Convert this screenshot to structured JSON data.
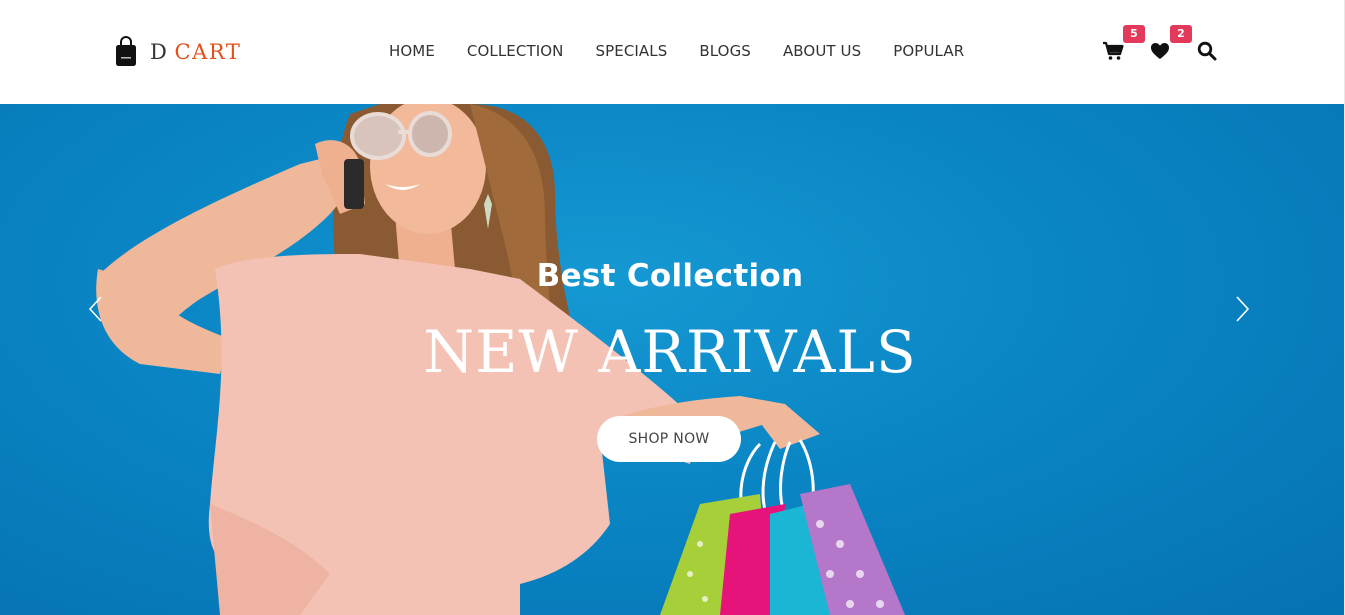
{
  "brand": {
    "name_prefix": "D",
    "name_accent": "CART",
    "icon": "shopping-bag-icon",
    "accent_color": "#e1521a"
  },
  "nav": {
    "items": [
      {
        "label": "HOME"
      },
      {
        "label": "COLLECTION"
      },
      {
        "label": "SPECIALS"
      },
      {
        "label": "BLOGS"
      },
      {
        "label": "ABOUT US"
      },
      {
        "label": "POPULAR"
      }
    ]
  },
  "header_icons": {
    "cart": {
      "icon": "cart-icon",
      "count": "5"
    },
    "wishlist": {
      "icon": "heart-icon",
      "count": "2"
    },
    "search": {
      "icon": "search-icon"
    },
    "badge_color": "#e33a5b"
  },
  "hero": {
    "subtitle": "Best Collection",
    "title": "NEW ARRIVALS",
    "cta_label": "SHOP NOW",
    "prev_icon": "chevron-left-icon",
    "next_icon": "chevron-right-icon",
    "background_color": "#0a85c4"
  }
}
